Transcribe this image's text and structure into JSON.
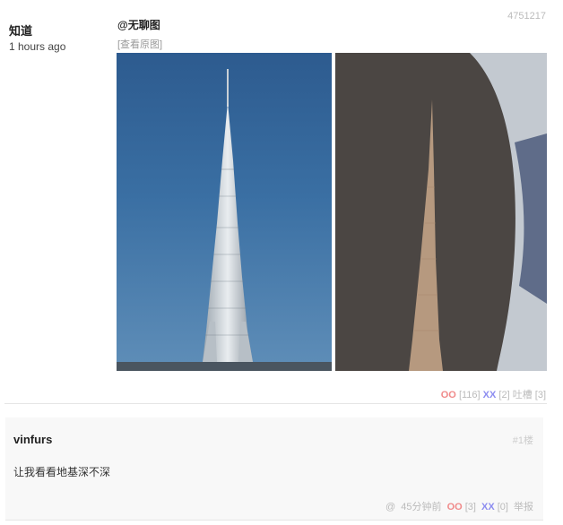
{
  "post": {
    "author": "知道",
    "time": "1 hours ago",
    "id": "4751217",
    "tag": "@无聊图",
    "view_original": "[查看原图]",
    "votes": {
      "oo_label": "OO",
      "oo_count": "[116]",
      "xx_label": "XX",
      "xx_count": "[2]",
      "tucao_label": "吐槽",
      "tucao_count": "[3]"
    }
  },
  "comment": {
    "user": "vinfurs",
    "floor": "#1楼",
    "text": "让我看看地基深不深",
    "at": "@",
    "time": "45分钟前",
    "oo_label": "OO",
    "oo_count": "[3]",
    "xx_label": "XX",
    "xx_count": "[0]",
    "report": "举报"
  }
}
